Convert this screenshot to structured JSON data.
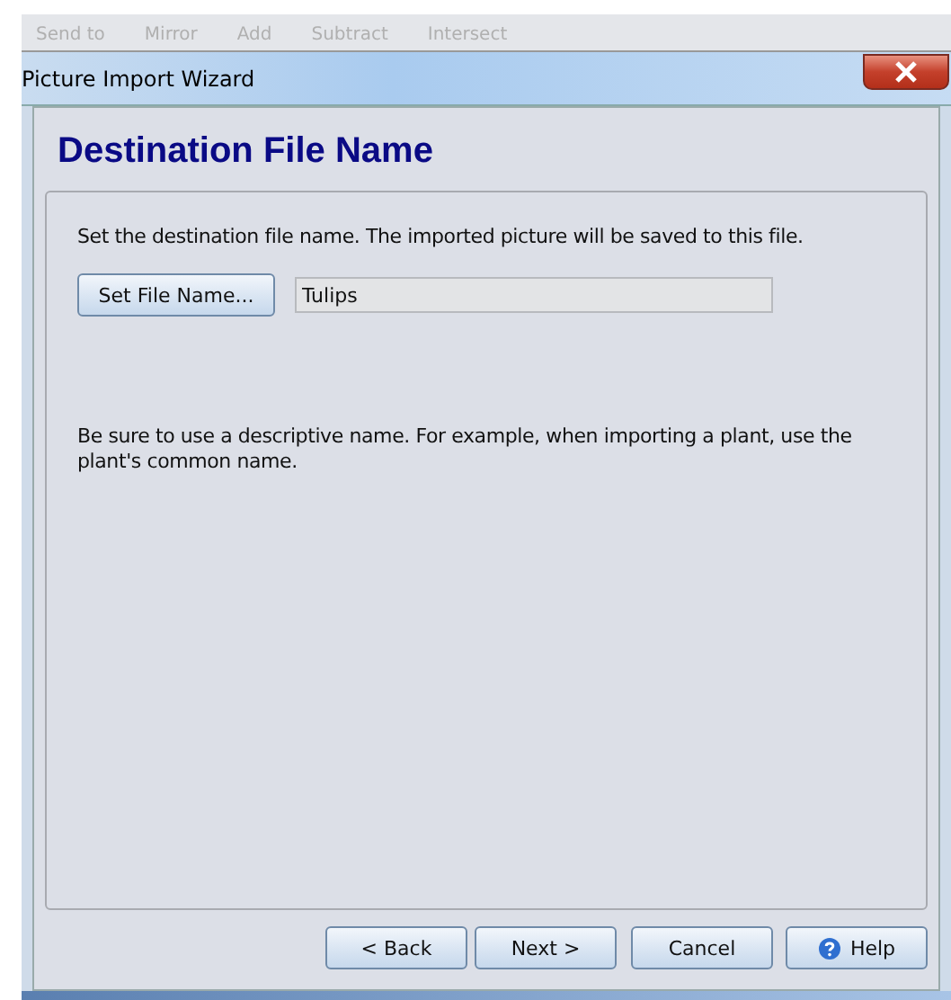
{
  "background_toolbar": {
    "items": [
      {
        "label": "Send to"
      },
      {
        "label": "Mirror"
      },
      {
        "label": "Add"
      },
      {
        "label": "Subtract"
      },
      {
        "label": "Intersect"
      }
    ]
  },
  "window": {
    "title": "Picture Import Wizard"
  },
  "page": {
    "heading": "Destination File Name",
    "instruction": "Set the destination file name. The imported picture will be saved to this file.",
    "set_file_name_button": "Set File Name...",
    "file_name": {
      "value": "Tulips"
    },
    "hint": "Be sure to use a descriptive name. For example, when importing a plant, use the plant's common name."
  },
  "buttons": [
    {
      "label": "< Back",
      "kind": "plain"
    },
    {
      "label": "Next >",
      "kind": "plain"
    },
    {
      "label": "Cancel",
      "kind": "plain"
    },
    {
      "label": "Help",
      "kind": "help"
    }
  ]
}
